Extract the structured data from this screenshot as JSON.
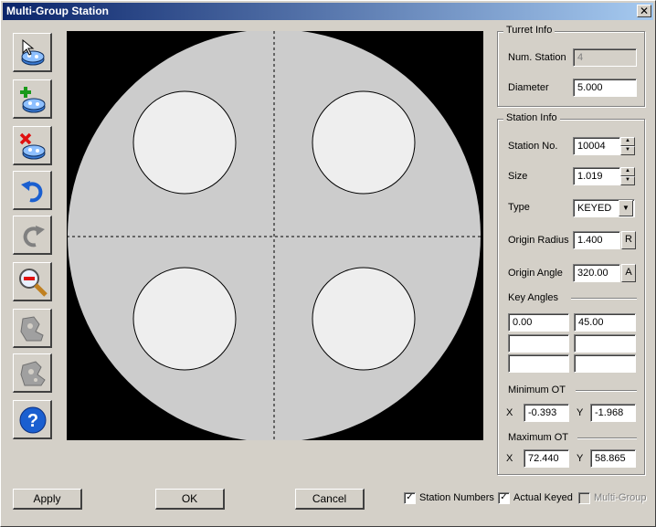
{
  "window": {
    "title": "Multi-Group Station",
    "close_glyph": "✕"
  },
  "toolbar": {
    "buttons": [
      {
        "name": "select-station-icon"
      },
      {
        "name": "add-station-icon"
      },
      {
        "name": "delete-station-icon"
      },
      {
        "name": "undo-icon"
      },
      {
        "name": "redo-icon"
      },
      {
        "name": "zoom-out-icon"
      },
      {
        "name": "punch-tool-icon"
      },
      {
        "name": "punch-tool-alt-icon"
      },
      {
        "name": "help-icon"
      }
    ]
  },
  "turret_info": {
    "title": "Turret Info",
    "num_station_label": "Num. Station",
    "num_station_value": "4",
    "diameter_label": "Diameter",
    "diameter_value": "5.000"
  },
  "station_info": {
    "title": "Station Info",
    "station_no_label": "Station No.",
    "station_no_value": "10004",
    "size_label": "Size",
    "size_value": "1.019",
    "type_label": "Type",
    "type_value": "KEYED",
    "origin_radius_label": "Origin Radius",
    "origin_radius_value": "1.400",
    "origin_radius_btn": "R",
    "origin_angle_label": "Origin Angle",
    "origin_angle_value": "320.00",
    "origin_angle_btn": "A",
    "key_angles_label": "Key Angles",
    "key_angles": [
      "0.00",
      "45.00",
      "",
      "",
      "",
      ""
    ],
    "min_ot_label": "Minimum OT",
    "min_ot_x_label": "X",
    "min_ot_x": "-0.393",
    "min_ot_y_label": "Y",
    "min_ot_y": "-1.968",
    "max_ot_label": "Maximum OT",
    "max_ot_x_label": "X",
    "max_ot_x": "72.440",
    "max_ot_y_label": "Y",
    "max_ot_y": "58.865"
  },
  "buttons": {
    "apply": "Apply",
    "ok": "OK",
    "cancel": "Cancel"
  },
  "checkboxes": {
    "station_numbers": {
      "label": "Station Numbers",
      "checked": true
    },
    "actual_keyed": {
      "label": "Actual Keyed",
      "checked": true
    },
    "multi_group": {
      "label": "Multi-Group",
      "checked": false,
      "disabled": true
    }
  },
  "colors": {
    "title_start": "#0a246a",
    "title_end": "#a6caf0",
    "face": "#d4d0c8",
    "turret": "#cccccc",
    "station": "#eeeeee"
  }
}
